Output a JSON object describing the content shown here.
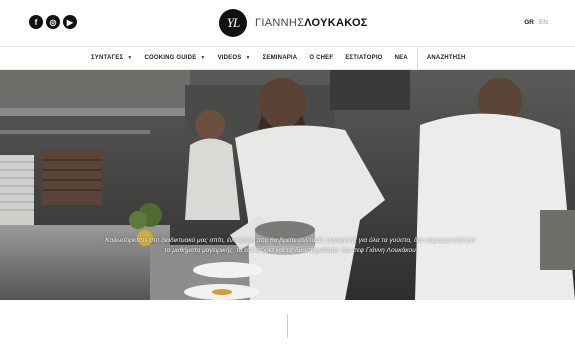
{
  "header": {
    "social": [
      {
        "icon": "facebook-icon",
        "glyph": "f"
      },
      {
        "icon": "instagram-icon",
        "glyph": "◎"
      },
      {
        "icon": "youtube-icon",
        "glyph": "▶"
      }
    ],
    "logo_mark": "YL",
    "brand_first": "ΓΙΑΝΝΗΣ",
    "brand_last": "ΛΟΥΚΑΚΟΣ",
    "lang_active": "GR",
    "lang_inactive": "EN"
  },
  "nav": {
    "items": [
      {
        "label": "ΣΥΝΤΑΓΕΣ",
        "dropdown": true
      },
      {
        "label": "COOKING GUIDE",
        "dropdown": true
      },
      {
        "label": "VIDEOS",
        "dropdown": true
      },
      {
        "label": "ΣΕΜΙΝΑΡΙΑ",
        "dropdown": false
      },
      {
        "label": "Ο CHEF",
        "dropdown": false
      },
      {
        "label": "ΕΣΤΙΑΤΟΡΙΟ",
        "dropdown": false
      },
      {
        "label": "ΝΕΑ",
        "dropdown": false
      }
    ],
    "search_label": "ΑΝΑΖΗΤΗΣΗ"
  },
  "hero": {
    "text": "Καλωσορίσατε στο διαδικτυακό μας σπίτι, ένα χώρο που θα βρείτε συνταγές μαγειρικής για όλα τα γούστα, δια επιμορφωτικά για τα μαθήματα μαγειρικής, τα εστιατόρια και τις δραστηριότητες του σεφ Γιάννη Λουκάκου"
  }
}
